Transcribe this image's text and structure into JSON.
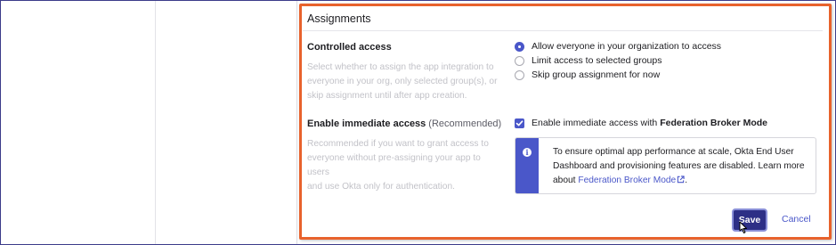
{
  "section": {
    "title": "Assignments"
  },
  "controlled_access": {
    "label": "Controlled access",
    "description_lines": [
      "Select whether to assign the app integration to",
      "everyone in your org, only selected group(s), or",
      "skip assignment until after app creation."
    ],
    "options": [
      {
        "label": "Allow everyone in your organization to access",
        "checked": true
      },
      {
        "label": "Limit access to selected groups",
        "checked": false
      },
      {
        "label": "Skip group assignment for now",
        "checked": false
      }
    ]
  },
  "immediate_access": {
    "label": "Enable immediate access",
    "label_suffix": "(Recommended)",
    "description_lines": [
      "Recommended if you want to grant access to",
      "everyone without pre-assigning your app to users",
      "and use Okta only for authentication."
    ],
    "checkbox_label_prefix": "Enable immediate access with",
    "checkbox_label_bold": "Federation Broker Mode",
    "checked": true
  },
  "info": {
    "icon": "info-icon",
    "line1": "To ensure optimal app performance at scale, Okta End User",
    "line2": "Dashboard and provisioning features are disabled. Learn more",
    "line3_prefix": "about",
    "link_text": "Federation Broker Mode",
    "line3_suffix": "."
  },
  "actions": {
    "save_label": "Save",
    "cancel_label": "Cancel"
  },
  "colors": {
    "accent": "#4a57c9",
    "primary_button": "#2d2f86",
    "highlight_border": "#e8622c"
  }
}
